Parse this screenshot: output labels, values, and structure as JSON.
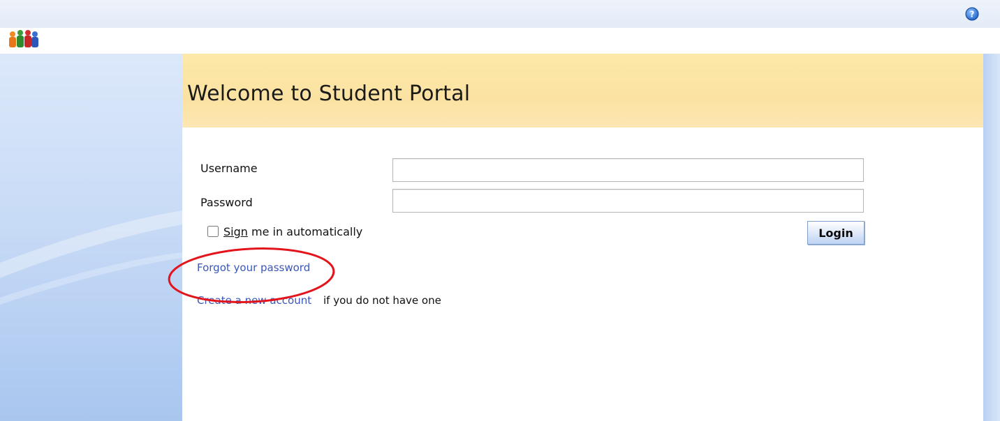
{
  "header": {
    "help_icon": "help-icon",
    "logo_icon": "people-group-icon"
  },
  "banner": {
    "title": "Welcome to Student Portal"
  },
  "login_form": {
    "username_label": "Username",
    "username_value": "",
    "password_label": "Password",
    "password_value": "",
    "remember_checked": false,
    "remember_mnemonic": "Sign",
    "remember_rest": " me in automatically",
    "login_label": "Login"
  },
  "links": {
    "forgot_password": "Forgot your password",
    "create_account": "Create a new account",
    "create_account_suffix": "if you do not have one"
  },
  "colors": {
    "banner": "#fbe2a2",
    "link": "#3a57b8",
    "annotation": "#e3141b",
    "side_panel": "#c8dbf6"
  }
}
